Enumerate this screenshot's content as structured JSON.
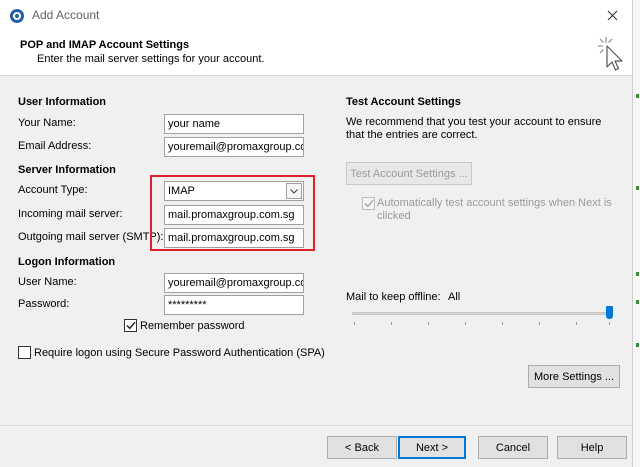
{
  "window": {
    "title": "Add Account",
    "icon": "outlook-gear-icon",
    "close_icon": "close-icon"
  },
  "header": {
    "title": "POP and IMAP Account Settings",
    "subtitle": "Enter the mail server settings for your account.",
    "icon": "cursor-click-icon"
  },
  "user_info": {
    "section": "User Information",
    "name_label": "Your Name:",
    "name_value": "your name",
    "email_label": "Email Address:",
    "email_value": "youremail@promaxgroup.com"
  },
  "server_info": {
    "section": "Server Information",
    "account_type_label": "Account Type:",
    "account_type_value": "IMAP",
    "incoming_label": "Incoming mail server:",
    "incoming_value": "mail.promaxgroup.com.sg",
    "outgoing_label": "Outgoing mail server (SMTP):",
    "outgoing_value": "mail.promaxgroup.com.sg"
  },
  "logon_info": {
    "section": "Logon Information",
    "user_label": "User Name:",
    "user_value": "youremail@promaxgroup.com",
    "password_label": "Password:",
    "password_value": "*********",
    "remember_label": "Remember password",
    "remember_checked": true,
    "spa_label": "Require logon using Secure Password Authentication (SPA)",
    "spa_checked": false
  },
  "test_settings": {
    "section": "Test Account Settings",
    "description": "We recommend that you test your account to ensure that the entries are correct.",
    "test_button": "Test Account Settings ...",
    "auto_test_label": "Automatically test account settings when Next is clicked",
    "auto_test_checked": true
  },
  "offline": {
    "label": "Mail to keep offline:",
    "value": "All",
    "slider_fraction": 1.0
  },
  "buttons": {
    "more_settings": "More Settings ...",
    "back": "< Back",
    "next": "Next >",
    "cancel": "Cancel",
    "help": "Help"
  },
  "colors": {
    "highlight": "#e0202a",
    "slider_accent": "#0078d7"
  }
}
